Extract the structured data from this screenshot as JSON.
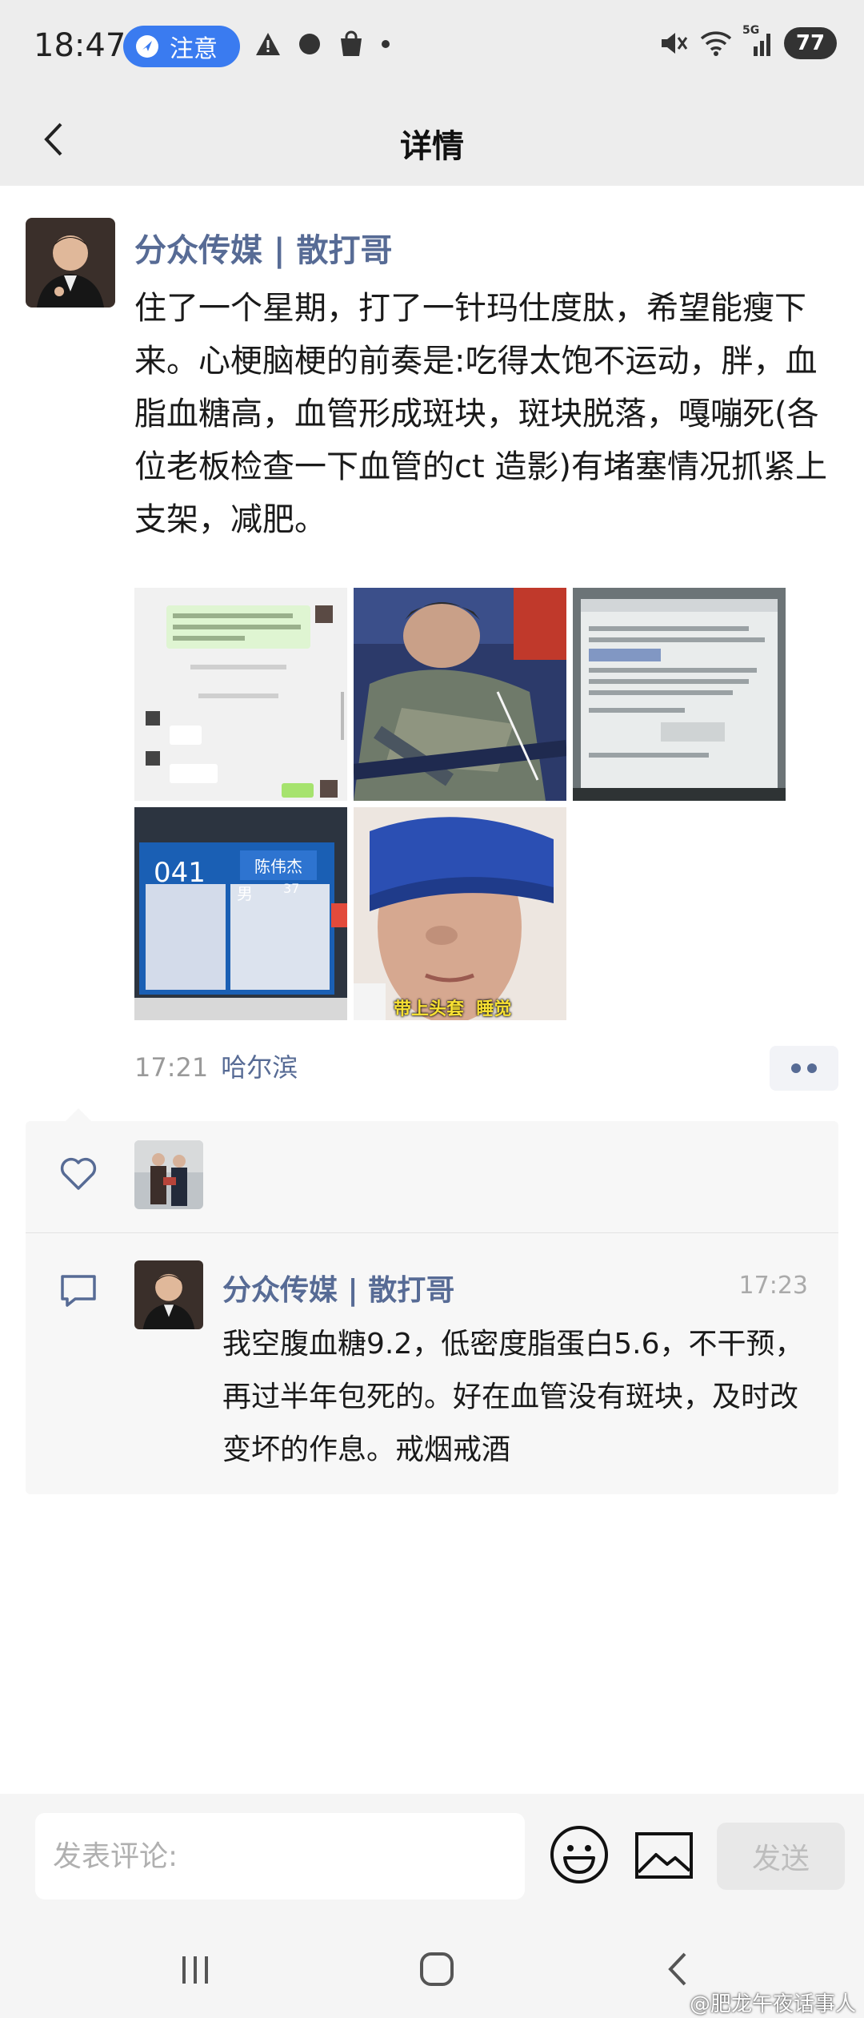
{
  "status_bar": {
    "time": "18:47",
    "notice_label": "注意",
    "battery": "77",
    "network": "5G"
  },
  "header": {
    "title": "详情"
  },
  "post": {
    "author": "分众传媒 | 散打哥",
    "text": "住了一个星期，打了一针玛仕度肽，希望能瘦下来。心梗脑梗的前奏是:吃得太饱不运动，胖，血脂血糖高，血管形成斑块，斑块脱落，嘎嘣死(各位老板检查一下血管的ct 造影)有堵塞情况抓紧上支架，减肥。",
    "time": "17:21",
    "location": "哈尔滨",
    "photos": [
      {
        "name": "chat-screenshot-photo",
        "caption": ""
      },
      {
        "name": "patient-in-bed-photo",
        "caption": ""
      },
      {
        "name": "medical-report-photo",
        "caption": ""
      },
      {
        "name": "hospital-screen-photo",
        "screen_number": "041",
        "screen_name": "陈伟杰",
        "screen_gender": "男",
        "screen_age": "37"
      },
      {
        "name": "eye-mask-photo",
        "caption": "带上头套  睡觉"
      }
    ]
  },
  "interactions": {
    "comment": {
      "author": "分众传媒 | 散打哥",
      "time": "17:23",
      "text": "我空腹血糖9.2，低密度脂蛋白5.6，不干预，再过半年包死的。好在血管没有斑块，及时改变坏的作息。戒烟戒酒"
    }
  },
  "input_bar": {
    "placeholder": "发表评论:",
    "send_label": "发送"
  },
  "watermark": "@肥龙午夜话事人",
  "colors": {
    "link": "#576b95",
    "accent": "#3a7bf0",
    "background": "#ededed"
  }
}
